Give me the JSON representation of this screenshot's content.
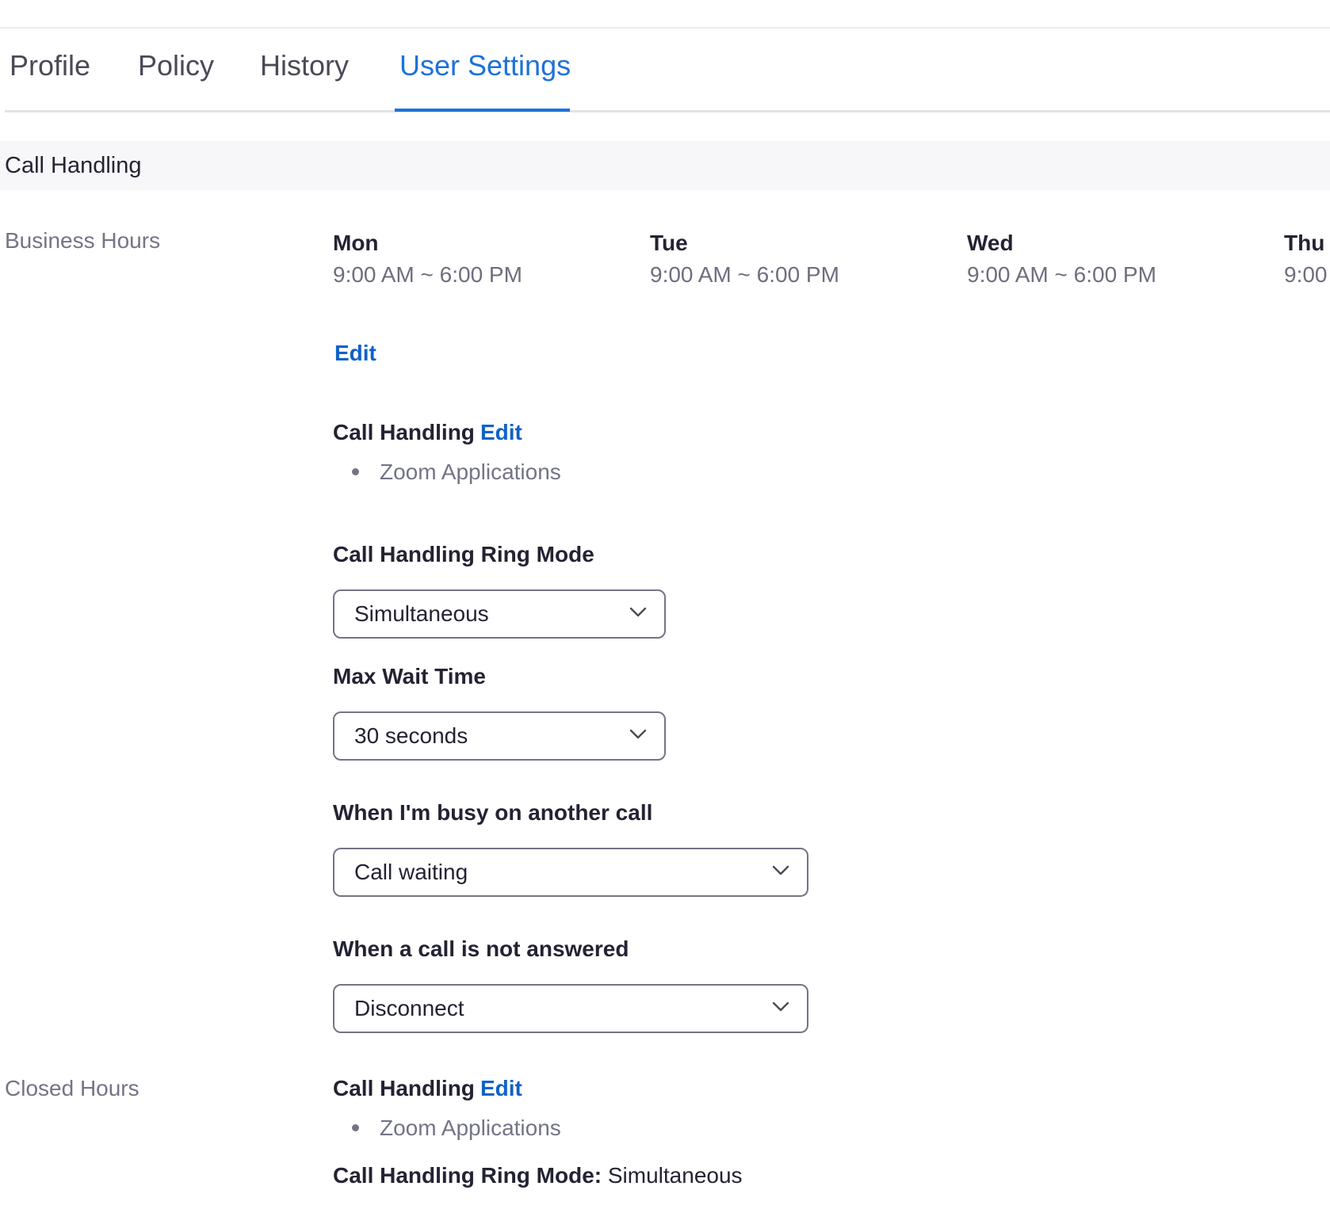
{
  "tabs": [
    {
      "label": "Profile",
      "active": false
    },
    {
      "label": "Policy",
      "active": false
    },
    {
      "label": "History",
      "active": false
    },
    {
      "label": "User Settings",
      "active": true
    }
  ],
  "section": {
    "title": "Call Handling"
  },
  "business_hours": {
    "label": "Business Hours",
    "days": [
      {
        "name": "Mon",
        "hours": "9:00 AM ~ 6:00 PM"
      },
      {
        "name": "Tue",
        "hours": "9:00 AM ~ 6:00 PM"
      },
      {
        "name": "Wed",
        "hours": "9:00 AM ~ 6:00 PM"
      },
      {
        "name": "Thu",
        "hours": "9:00"
      }
    ],
    "edit_label": "Edit",
    "call_handling": {
      "title": "Call Handling",
      "edit_label": "Edit",
      "items": [
        "Zoom Applications"
      ]
    },
    "ring_mode": {
      "label": "Call Handling Ring Mode",
      "value": "Simultaneous"
    },
    "max_wait": {
      "label": "Max Wait Time",
      "value": "30 seconds"
    },
    "busy": {
      "label": "When I'm busy on another call",
      "value": "Call waiting"
    },
    "not_answered": {
      "label": "When a call is not answered",
      "value": "Disconnect"
    }
  },
  "closed_hours": {
    "label": "Closed Hours",
    "call_handling": {
      "title": "Call Handling",
      "edit_label": "Edit",
      "items": [
        "Zoom Applications"
      ]
    },
    "ring_mode": {
      "label": "Call Handling Ring Mode:",
      "value": "Simultaneous"
    }
  },
  "colors": {
    "accent": "#1d72d9",
    "link": "#0e62c8",
    "muted_text": "#747487",
    "section_band": "#f7f7f9"
  },
  "icons": {
    "dropdown": "chevron-down-icon"
  }
}
